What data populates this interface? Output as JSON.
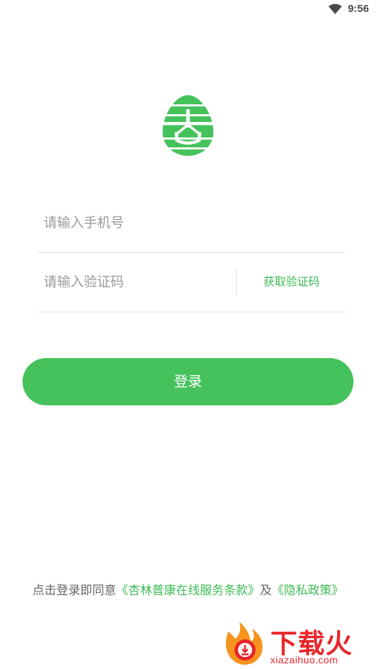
{
  "status_bar": {
    "time": "9:56",
    "wifi_icon": "wifi-icon"
  },
  "logo": {
    "icon": "xinglin-logo-icon",
    "color": "#45c25b"
  },
  "form": {
    "phone_placeholder": "请输入手机号",
    "phone_value": "",
    "code_placeholder": "请输入验证码",
    "code_value": "",
    "get_code_label": "获取验证码"
  },
  "login_button": {
    "label": "登录",
    "color": "#45c25b"
  },
  "agreement": {
    "prefix": "点击登录即同意",
    "terms_link": "《杏林普康在线服务条款》",
    "conjunction": "及",
    "privacy_link": "《隐私政策》",
    "link_color": "#3dbb55"
  },
  "watermark": {
    "title": "下载火",
    "subtitle": "xiazaihuo.com",
    "color": "#e8262b"
  }
}
